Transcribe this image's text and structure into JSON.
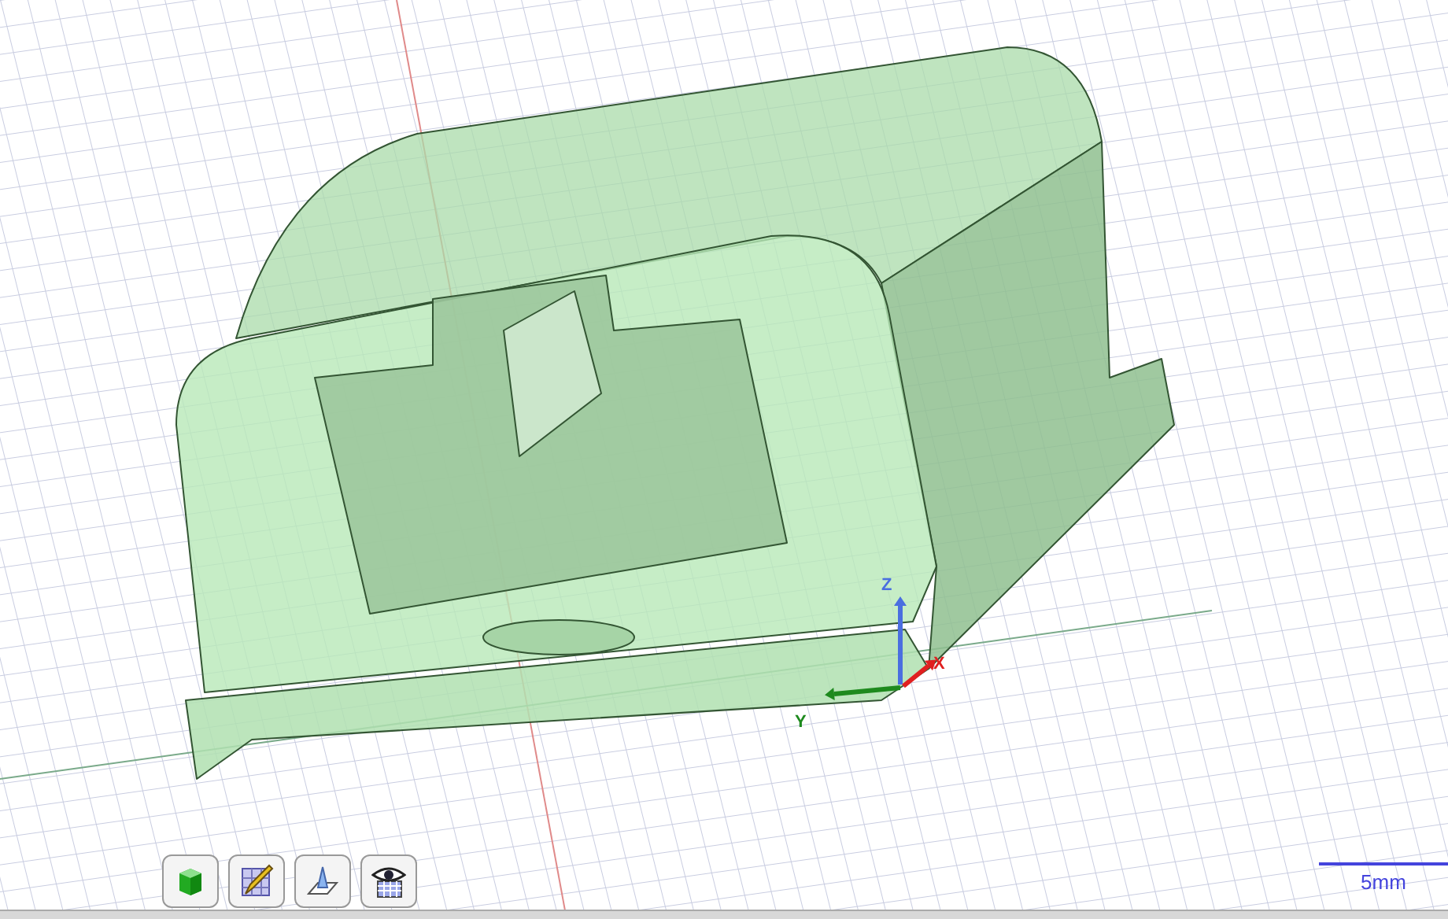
{
  "viewport": {
    "axes": [
      {
        "kind": "z",
        "label": "Z"
      },
      {
        "kind": "y",
        "label": "Y"
      },
      {
        "kind": "x",
        "label": "X"
      }
    ]
  },
  "toolbar": {
    "buttons": [
      {
        "kind": "solid"
      },
      {
        "kind": "sketch"
      },
      {
        "kind": "plane"
      },
      {
        "kind": "view"
      }
    ]
  },
  "scale_bar": {
    "label": "5mm"
  }
}
